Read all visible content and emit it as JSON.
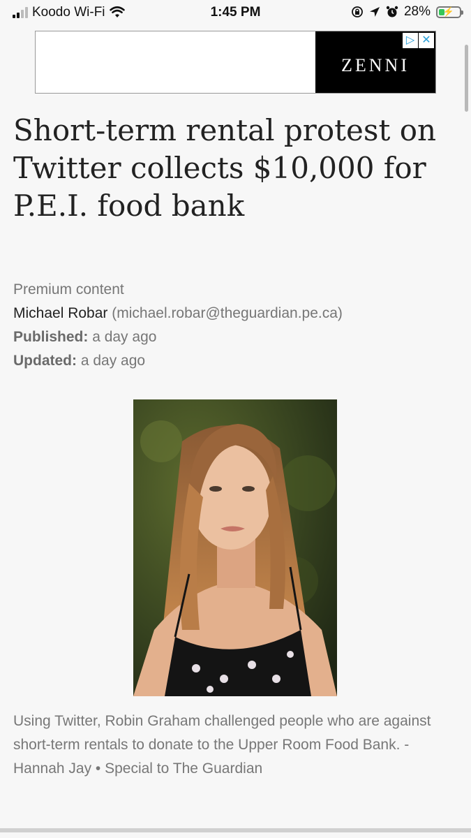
{
  "status": {
    "carrier": "Koodo Wi-Fi",
    "time": "1:45 PM",
    "battery": "28%",
    "battery_level": 0.28,
    "icons": [
      "signal-icon",
      "wifi-icon",
      "screen-lock-icon",
      "location-icon",
      "alarm-icon",
      "battery-icon"
    ]
  },
  "ad": {
    "brand": "ZENNI",
    "choices": [
      "ad-choices-icon",
      "close-icon"
    ]
  },
  "article": {
    "headline": "Short-term rental protest on Twitter collects $10,000 for P.E.I. food bank",
    "premium": "Premium content",
    "author": "Michael Robar",
    "email": "(michael.robar@theguardian.pe.ca)",
    "published_label": "Published:",
    "published_value": "a day ago",
    "updated_label": "Updated:",
    "updated_value": "a day ago",
    "caption": "Using Twitter, Robin Graham challenged people who are against short-term rentals to donate to the Upper Room Food Bank. - Hannah Jay • Special to The Guardian"
  },
  "colors": {
    "accent_ad": "#2a9fd8",
    "battery_green": "#34c759"
  }
}
